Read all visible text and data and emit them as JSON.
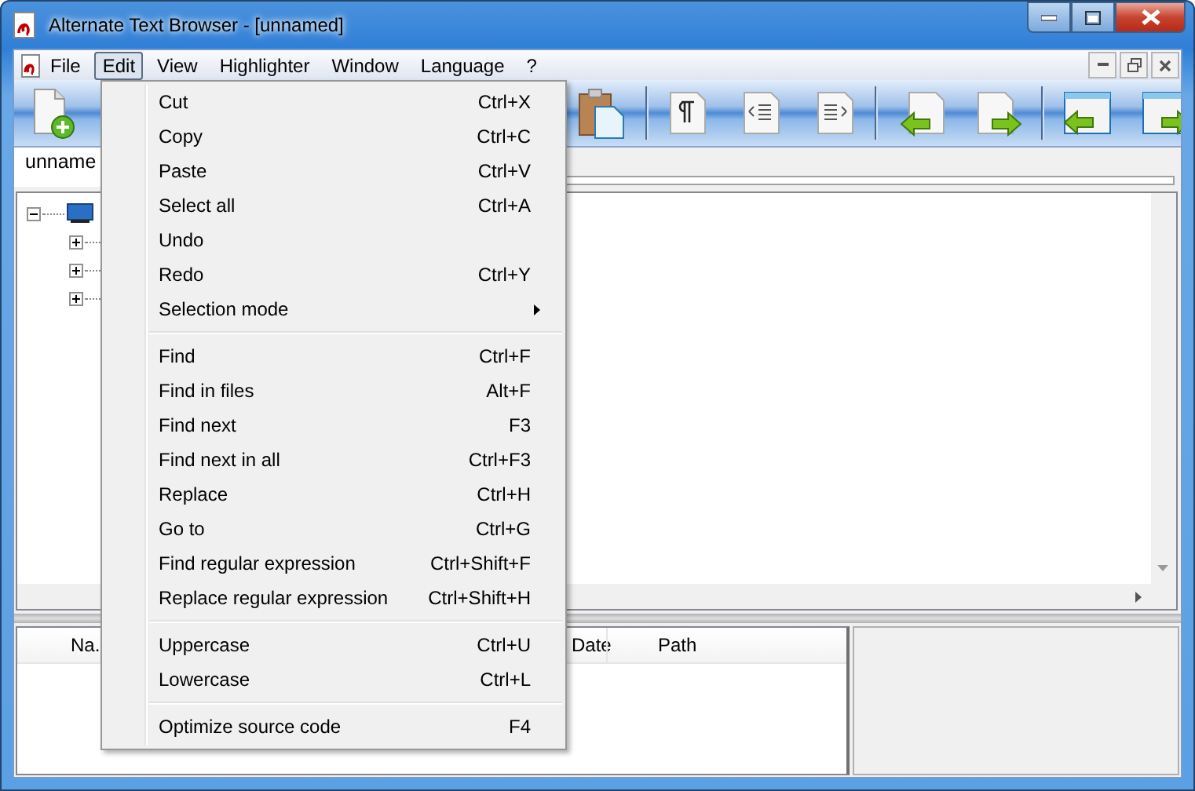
{
  "window": {
    "title": "Alternate Text Browser  - [unnamed]"
  },
  "menu_bar": [
    {
      "label": "File",
      "selected": false
    },
    {
      "label": "Edit",
      "selected": true
    },
    {
      "label": "View",
      "selected": false
    },
    {
      "label": "Highlighter",
      "selected": false
    },
    {
      "label": "Window",
      "selected": false
    },
    {
      "label": "Language",
      "selected": false
    },
    {
      "label": "?",
      "selected": false
    }
  ],
  "tabs": [
    {
      "label": "unname"
    }
  ],
  "tree": [
    {
      "expanded": true,
      "children": [
        {
          "expanded": false
        },
        {
          "expanded": false
        },
        {
          "expanded": false
        }
      ]
    }
  ],
  "file_list": {
    "columns": [
      "Na.",
      "Date",
      "Path"
    ]
  },
  "edit_menu": [
    {
      "kind": "item",
      "label": "Cut",
      "shortcut": "Ctrl+X"
    },
    {
      "kind": "item",
      "label": "Copy",
      "shortcut": "Ctrl+C"
    },
    {
      "kind": "item",
      "label": "Paste",
      "shortcut": "Ctrl+V"
    },
    {
      "kind": "item",
      "label": "Select all",
      "shortcut": "Ctrl+A"
    },
    {
      "kind": "item",
      "label": "Undo"
    },
    {
      "kind": "item",
      "label": "Redo",
      "shortcut": "Ctrl+Y"
    },
    {
      "kind": "submenu",
      "label": "Selection mode"
    },
    {
      "kind": "separator"
    },
    {
      "kind": "item",
      "label": "Find",
      "shortcut": "Ctrl+F"
    },
    {
      "kind": "item",
      "label": "Find in files",
      "shortcut": "Alt+F"
    },
    {
      "kind": "item",
      "label": "Find next",
      "shortcut": "F3"
    },
    {
      "kind": "item",
      "label": "Find next in all",
      "shortcut": "Ctrl+F3"
    },
    {
      "kind": "item",
      "label": "Replace",
      "shortcut": "Ctrl+H"
    },
    {
      "kind": "item",
      "label": "Go to",
      "shortcut": "Ctrl+G"
    },
    {
      "kind": "item",
      "label": "Find regular expression",
      "shortcut": "Ctrl+Shift+F"
    },
    {
      "kind": "item",
      "label": "Replace regular expression",
      "shortcut": "Ctrl+Shift+H"
    },
    {
      "kind": "separator"
    },
    {
      "kind": "item",
      "label": "Uppercase",
      "shortcut": "Ctrl+U"
    },
    {
      "kind": "item",
      "label": "Lowercase",
      "shortcut": "Ctrl+L"
    },
    {
      "kind": "separator"
    },
    {
      "kind": "item",
      "label": "Optimize source code",
      "shortcut": "F4"
    }
  ]
}
